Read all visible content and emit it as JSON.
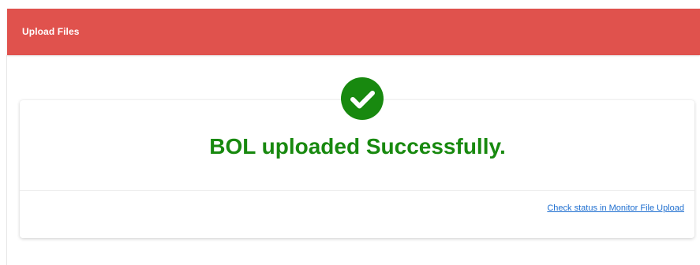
{
  "header": {
    "title": "Upload Files"
  },
  "result": {
    "message": "BOL uploaded Successfully.",
    "icon": "check-circle-icon"
  },
  "footer": {
    "link_text": "Check status in Monitor File Upload"
  },
  "colors": {
    "header_bg": "#e0524d",
    "success_green": "#18890f",
    "link_blue": "#1f6fd0"
  }
}
